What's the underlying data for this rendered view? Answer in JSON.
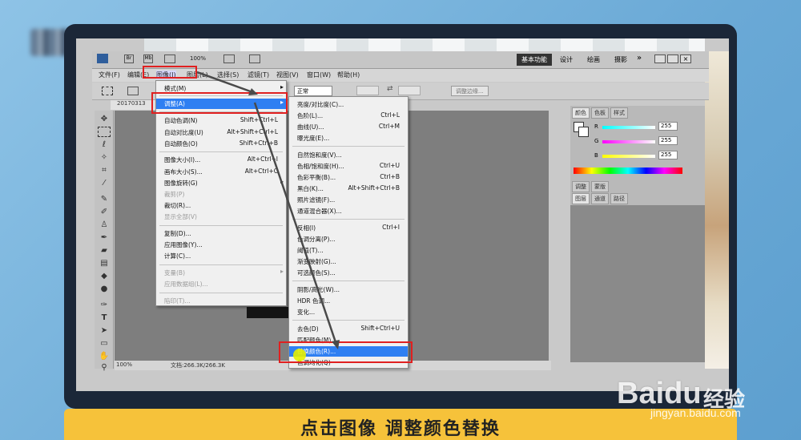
{
  "app": {
    "doc_tab": "20170313",
    "zoom": "100%",
    "zoom_status": "100%",
    "file_info": "文档:266.3K/266.3K",
    "workspace_active": "基本功能",
    "workspaces": [
      "设计",
      "绘画",
      "摄影"
    ],
    "more": "»"
  },
  "menu_bar": [
    "文件(F)",
    "编辑(E)",
    "图像(I)",
    "图层(L)",
    "选择(S)",
    "滤镜(T)",
    "视图(V)",
    "窗口(W)",
    "帮助(H)"
  ],
  "options": {
    "mode": "正常",
    "refine_edge": "调整边缘..."
  },
  "image_menu": [
    {
      "label": "模式(M)",
      "shortcut": "",
      "arrow": true,
      "disabled": false
    },
    {
      "label": "调整(A)",
      "shortcut": "",
      "arrow": true,
      "disabled": false,
      "highlight": true
    },
    {
      "label": "自动色调(N)",
      "shortcut": "Shift+Ctrl+L",
      "disabled": false
    },
    {
      "label": "自动对比度(U)",
      "shortcut": "Alt+Shift+Ctrl+L",
      "disabled": false
    },
    {
      "label": "自动颜色(O)",
      "shortcut": "Shift+Ctrl+B",
      "disabled": false
    },
    {
      "label": "图像大小(I)...",
      "shortcut": "Alt+Ctrl+I",
      "disabled": false
    },
    {
      "label": "画布大小(S)...",
      "shortcut": "Alt+Ctrl+C",
      "disabled": false
    },
    {
      "label": "图像旋转(G)",
      "shortcut": "",
      "arrow": true,
      "disabled": false
    },
    {
      "label": "裁剪(P)",
      "shortcut": "",
      "disabled": true
    },
    {
      "label": "裁切(R)...",
      "shortcut": "",
      "disabled": false
    },
    {
      "label": "显示全部(V)",
      "shortcut": "",
      "disabled": true
    },
    {
      "label": "复制(D)...",
      "shortcut": "",
      "disabled": false
    },
    {
      "label": "应用图像(Y)...",
      "shortcut": "",
      "disabled": false
    },
    {
      "label": "计算(C)...",
      "shortcut": "",
      "disabled": false
    },
    {
      "label": "变量(B)",
      "shortcut": "",
      "arrow": true,
      "disabled": true
    },
    {
      "label": "应用数据组(L)...",
      "shortcut": "",
      "disabled": true
    },
    {
      "label": "陷印(T)...",
      "shortcut": "",
      "disabled": true
    }
  ],
  "adjust_menu": [
    {
      "label": "亮度/对比度(C)...",
      "shortcut": ""
    },
    {
      "label": "色阶(L)...",
      "shortcut": "Ctrl+L"
    },
    {
      "label": "曲线(U)...",
      "shortcut": "Ctrl+M"
    },
    {
      "label": "曝光度(E)...",
      "shortcut": ""
    },
    {
      "label": "自然饱和度(V)...",
      "shortcut": ""
    },
    {
      "label": "色相/饱和度(H)...",
      "shortcut": "Ctrl+U"
    },
    {
      "label": "色彩平衡(B)...",
      "shortcut": "Ctrl+B"
    },
    {
      "label": "黑白(K)...",
      "shortcut": "Alt+Shift+Ctrl+B"
    },
    {
      "label": "照片滤镜(F)...",
      "shortcut": ""
    },
    {
      "label": "通道混合器(X)...",
      "shortcut": ""
    },
    {
      "label": "反相(I)",
      "shortcut": "Ctrl+I"
    },
    {
      "label": "色调分离(P)...",
      "shortcut": ""
    },
    {
      "label": "阈值(T)...",
      "shortcut": ""
    },
    {
      "label": "渐变映射(G)...",
      "shortcut": ""
    },
    {
      "label": "可选颜色(S)...",
      "shortcut": ""
    },
    {
      "label": "阴影/高光(W)...",
      "shortcut": ""
    },
    {
      "label": "HDR 色调...",
      "shortcut": ""
    },
    {
      "label": "变化...",
      "shortcut": ""
    },
    {
      "label": "去色(D)",
      "shortcut": "Shift+Ctrl+U"
    },
    {
      "label": "匹配颜色(M)...",
      "shortcut": ""
    },
    {
      "label": "替换颜色(R)...",
      "shortcut": "",
      "highlight": true
    },
    {
      "label": "色调均化(Q)",
      "shortcut": ""
    }
  ],
  "color_panel": {
    "tabs": [
      "颜色",
      "色板",
      "样式"
    ],
    "r_label": "R",
    "g_label": "G",
    "b_label": "B",
    "r": "255",
    "g": "255",
    "b": "255",
    "tabs2": [
      "调整",
      "蒙版"
    ],
    "tabs3": [
      "图层",
      "通道",
      "路径"
    ]
  },
  "caption": "点击图像 调整颜色替换",
  "watermark": {
    "logo": "Baidu",
    "cn": "经验",
    "url": "jingyan.baidu.com"
  },
  "colors": {
    "highlight": "#2f7ff2",
    "red_box": "#e02020",
    "caption_bg": "#f6c23a"
  }
}
